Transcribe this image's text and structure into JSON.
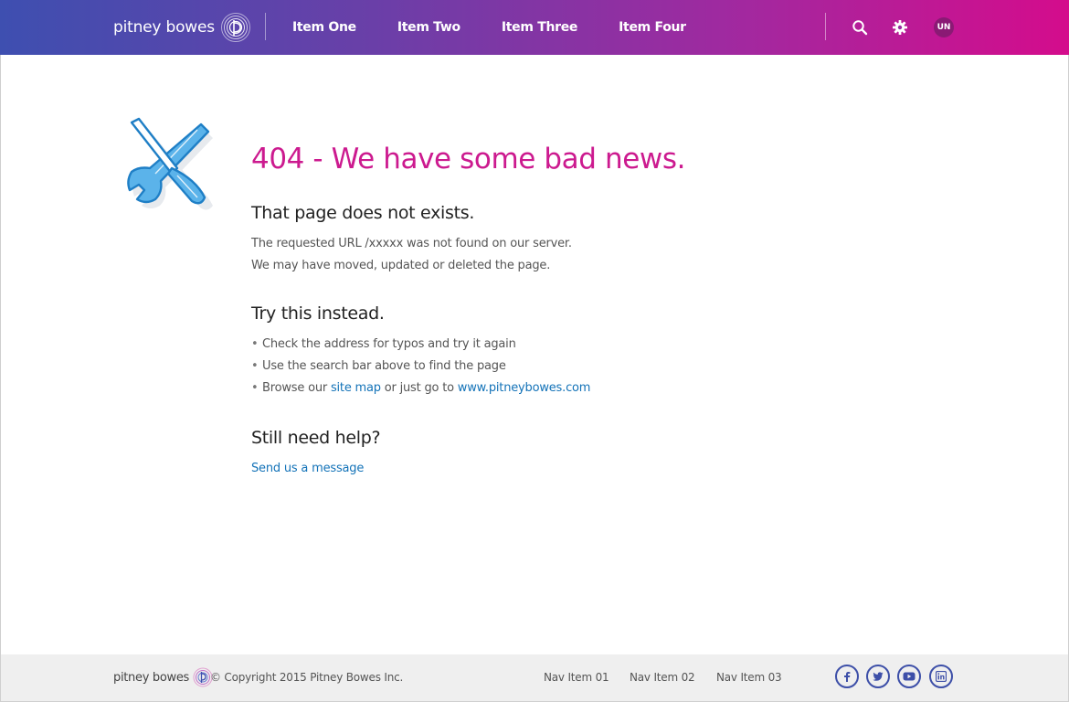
{
  "header": {
    "logo_text": "pitney bowes",
    "nav": [
      "Item One",
      "Item Two",
      "Item Three",
      "Item Four"
    ],
    "avatar_initials": "UN",
    "icons": {
      "search": "search-icon",
      "settings": "gear-icon"
    }
  },
  "main": {
    "title": "404 - We have some bad news.",
    "section1": {
      "heading": "That page does not exists.",
      "lines": [
        "The requested URL /xxxxx was not found on our server.",
        "We may have moved, updated or deleted the page."
      ]
    },
    "section2": {
      "heading": "Try this instead.",
      "bullet1": "Check the address for typos and try it again",
      "bullet2": "Use the search bar above to find the page",
      "bullet3": {
        "prefix": "Browse our ",
        "sitemap_link": "site map",
        "middle": " or just go to ",
        "website_link": "www.pitneybowes.com"
      },
      "bullet_char": "•"
    },
    "section3": {
      "heading": "Still need help?",
      "link": "Send us a message"
    },
    "illustration_icon": "tools-icon"
  },
  "footer": {
    "logo_text": "pitney bowes",
    "copyright": "© Copyright 2015 Pitney Bowes Inc.",
    "nav": [
      "Nav Item 01",
      "Nav Item 02",
      "Nav Item 03"
    ],
    "social": [
      "facebook-icon",
      "twitter-icon",
      "youtube-icon",
      "linkedin-icon"
    ]
  },
  "colors": {
    "brand_magenta": "#cc1a8f",
    "link_blue": "#1473b8",
    "header_gradient_start": "#3e4fb0",
    "header_gradient_end": "#d40c8c",
    "social_blue": "#3d4fa8"
  }
}
